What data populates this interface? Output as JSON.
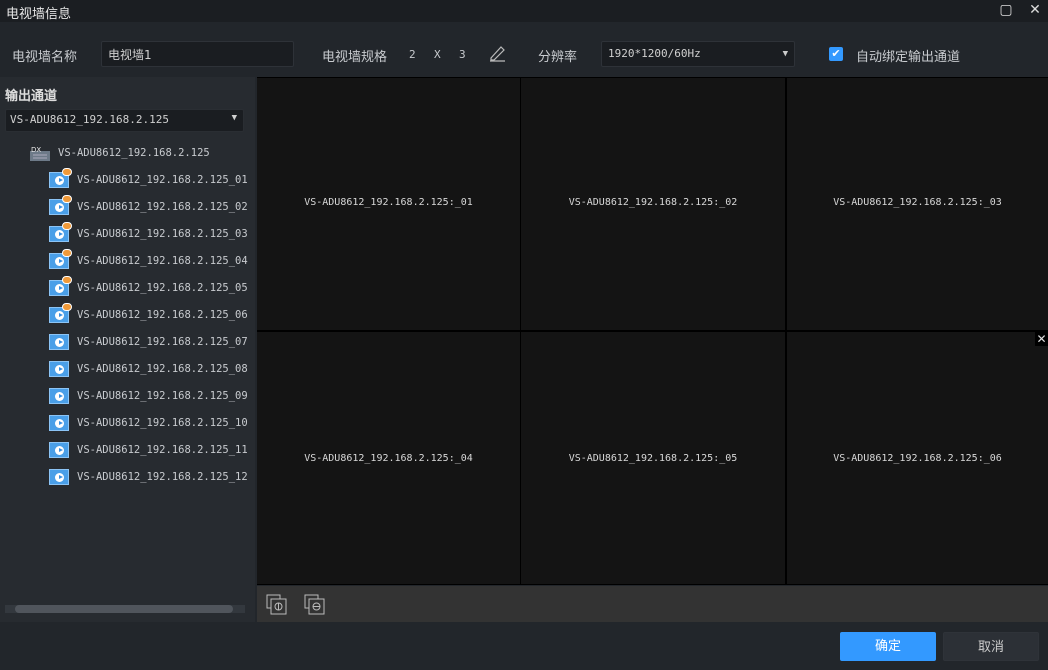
{
  "window": {
    "title": "电视墙信息",
    "maximize_icon": "maximize-icon",
    "close_icon": "close-icon"
  },
  "toolbar": {
    "name_label": "电视墙名称",
    "name_value": "电视墙1",
    "spec_label": "电视墙规格",
    "rows": "2",
    "x": "X",
    "cols": "3",
    "edit_icon": "pencil-icon",
    "resolution_label": "分辨率",
    "resolution_value": "1920*1200/60Hz",
    "auto_bind_label": "自动绑定输出通道",
    "auto_bind_checked": true
  },
  "left": {
    "title": "输出通道",
    "device_select": "VS-ADU8612_192.168.2.125",
    "device": "VS-ADU8612_192.168.2.125",
    "channels": [
      {
        "label": "VS-ADU8612_192.168.2.125_01",
        "bound": true
      },
      {
        "label": "VS-ADU8612_192.168.2.125_02",
        "bound": true
      },
      {
        "label": "VS-ADU8612_192.168.2.125_03",
        "bound": true
      },
      {
        "label": "VS-ADU8612_192.168.2.125_04",
        "bound": true
      },
      {
        "label": "VS-ADU8612_192.168.2.125_05",
        "bound": true
      },
      {
        "label": "VS-ADU8612_192.168.2.125_06",
        "bound": true
      },
      {
        "label": "VS-ADU8612_192.168.2.125_07",
        "bound": false
      },
      {
        "label": "VS-ADU8612_192.168.2.125_08",
        "bound": false
      },
      {
        "label": "VS-ADU8612_192.168.2.125_09",
        "bound": false
      },
      {
        "label": "VS-ADU8612_192.168.2.125_10",
        "bound": false
      },
      {
        "label": "VS-ADU8612_192.168.2.125_11",
        "bound": false
      },
      {
        "label": "VS-ADU8612_192.168.2.125_12",
        "bound": false
      }
    ]
  },
  "grid": {
    "cells": [
      "VS-ADU8612_192.168.2.125:_01",
      "VS-ADU8612_192.168.2.125:_02",
      "VS-ADU8612_192.168.2.125:_03",
      "VS-ADU8612_192.168.2.125:_04",
      "VS-ADU8612_192.168.2.125:_05",
      "VS-ADU8612_192.168.2.125:_06"
    ]
  },
  "footer": {
    "ok": "确定",
    "cancel": "取消",
    "accent": "#3399ff"
  }
}
